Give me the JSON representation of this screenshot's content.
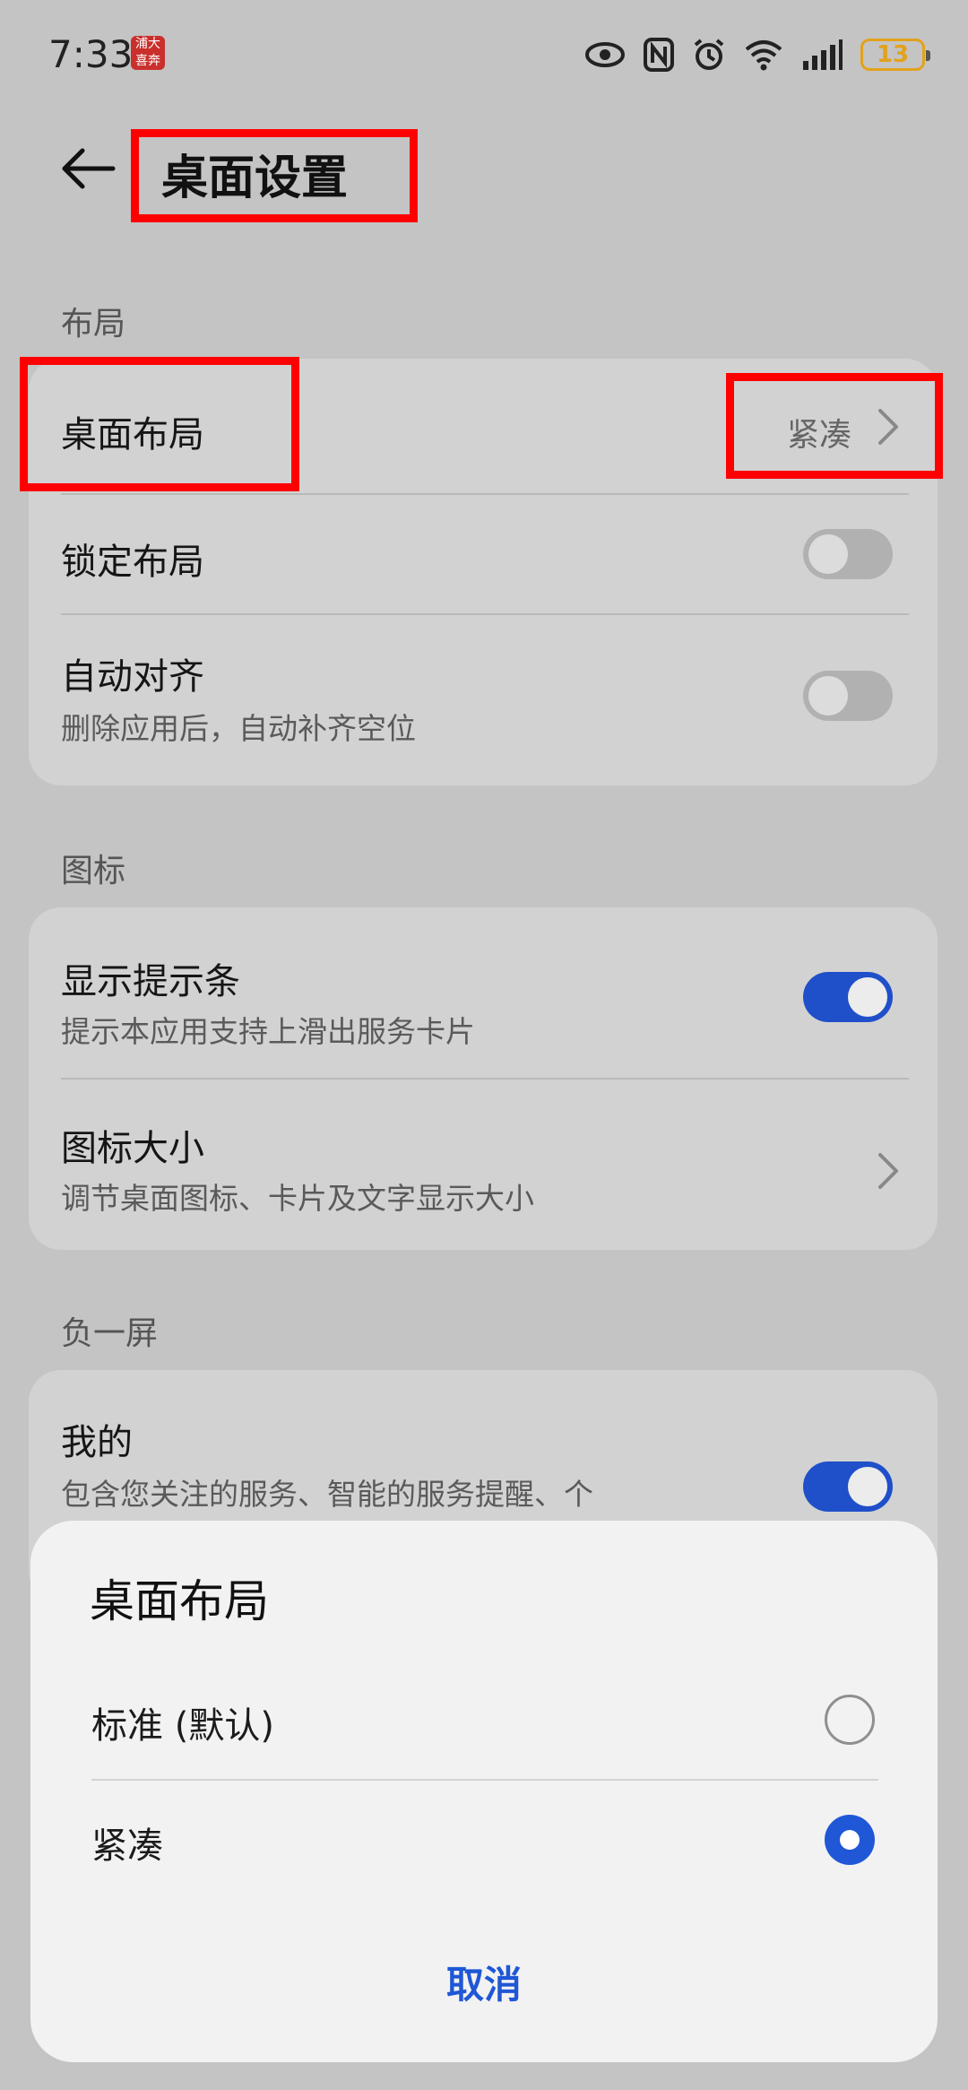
{
  "status_bar": {
    "time": "7:33",
    "app_badge": "浦大喜奔",
    "battery": "13"
  },
  "header": {
    "title": "桌面设置"
  },
  "sections": {
    "layout": {
      "label": "布局",
      "desktop_layout": {
        "title": "桌面布局",
        "value": "紧凑"
      },
      "lock_layout": {
        "title": "锁定布局",
        "enabled": false
      },
      "auto_align": {
        "title": "自动对齐",
        "subtitle": "删除应用后，自动补齐空位",
        "enabled": false
      }
    },
    "icons": {
      "label": "图标",
      "show_hint": {
        "title": "显示提示条",
        "subtitle": "提示本应用支持上滑出服务卡片",
        "enabled": true
      },
      "icon_size": {
        "title": "图标大小",
        "subtitle": "调节桌面图标、卡片及文字显示大小"
      }
    },
    "minus_one": {
      "label": "负一屏",
      "mine": {
        "title": "我的",
        "subtitle": "包含您关注的服务、智能的服务提醒、个",
        "enabled": true
      }
    }
  },
  "sheet": {
    "title": "桌面布局",
    "options": [
      {
        "label": "标准 (默认)",
        "selected": false
      },
      {
        "label": "紧凑",
        "selected": true
      }
    ],
    "cancel_label": "取消"
  },
  "colors": {
    "accent": "#1f57d6",
    "highlight": "#ff0000",
    "battery": "#e2a21c"
  }
}
